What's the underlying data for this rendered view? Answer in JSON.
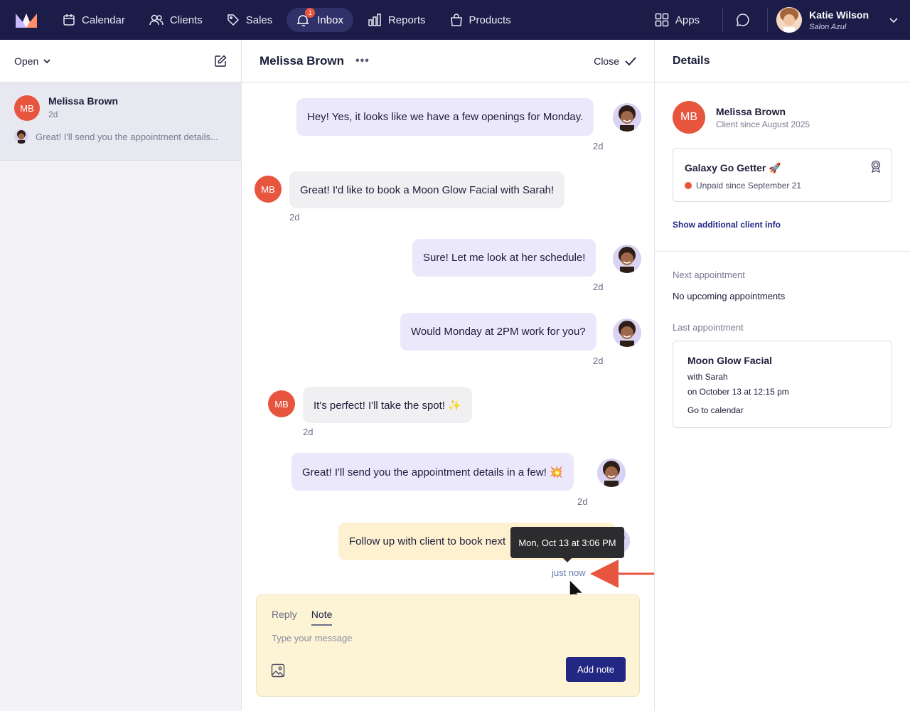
{
  "nav": {
    "items": [
      {
        "label": "Calendar",
        "icon": "calendar-icon"
      },
      {
        "label": "Clients",
        "icon": "users-icon"
      },
      {
        "label": "Sales",
        "icon": "tag-icon"
      },
      {
        "label": "Inbox",
        "icon": "inbox-bell-icon",
        "badge": "1",
        "active": true
      },
      {
        "label": "Reports",
        "icon": "bar-chart-icon"
      },
      {
        "label": "Products",
        "icon": "shopping-bag-icon"
      }
    ],
    "apps_label": "Apps",
    "user_name": "Katie Wilson",
    "user_salon": "Salon Azul"
  },
  "sidebar": {
    "filter_label": "Open",
    "conversation": {
      "initials": "MB",
      "name": "Melissa Brown",
      "time": "2d",
      "preview": "Great! I'll send you the appointment details..."
    }
  },
  "thread": {
    "title": "Melissa Brown",
    "close_label": "Close",
    "messages": [
      {
        "direction": "out",
        "text": "Hey! Yes, it looks like we have a few openings for Monday.",
        "time": "2d"
      },
      {
        "direction": "in",
        "initials": "MB",
        "text": "Great! I'd like to book a Moon Glow Facial with Sarah!",
        "time": "2d"
      },
      {
        "direction": "out",
        "text": "Sure! Let me look at her schedule!",
        "time": "2d"
      },
      {
        "direction": "out",
        "text": "Would Monday at 2PM work for you?",
        "time": "2d"
      },
      {
        "direction": "in",
        "initials": "MB",
        "text": "It's perfect! I'll take the spot! ✨",
        "time": "2d"
      },
      {
        "direction": "out",
        "text": "Great! I'll send you the appointment details in a few! 💥",
        "time": "2d"
      },
      {
        "direction": "note",
        "text": "Follow up with client to book next",
        "time": "just now"
      }
    ],
    "tooltip": "Mon, Oct 13 at 3:06 PM"
  },
  "composer": {
    "tab_reply": "Reply",
    "tab_note": "Note",
    "placeholder": "Type your message",
    "submit_label": "Add note"
  },
  "details": {
    "heading": "Details",
    "client_initials": "MB",
    "client_name": "Melissa Brown",
    "client_since": "Client since August 2025",
    "membership_title": "Galaxy Go Getter 🚀",
    "membership_status": "Unpaid since September 21",
    "show_more": "Show additional client info",
    "next_label": "Next appointment",
    "next_value": "No upcoming appointments",
    "last_label": "Last appointment",
    "last_service": "Moon Glow Facial",
    "last_with": "with Sarah",
    "last_when": "on October 13 at 12:15 pm",
    "last_link": "Go to calendar"
  },
  "colors": {
    "nav_bg": "#1b1c48",
    "accent": "#232784",
    "client_avatar": "#e8553f",
    "outgoing_bubble": "#ece8fc",
    "note_bubble": "#fdf1cf",
    "annotation_arrow": "#e8553f"
  }
}
